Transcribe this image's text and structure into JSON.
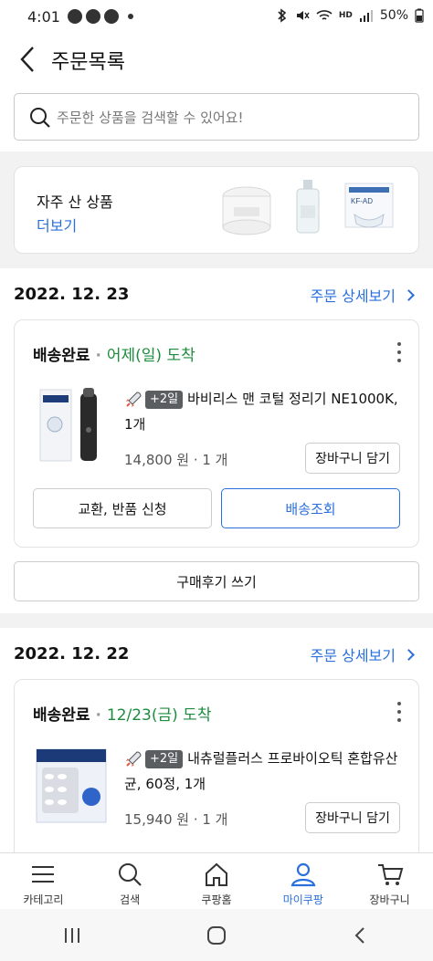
{
  "status_bar": {
    "time": "4:01",
    "net_label": "HD",
    "battery": "50%"
  },
  "header": {
    "title": "주문목록"
  },
  "search": {
    "placeholder": "주문한 상품을 검색할 수 있어요!"
  },
  "frequent": {
    "title": "자주 산 상품",
    "more": "더보기"
  },
  "orders": [
    {
      "date": "2022. 12. 23",
      "detail_link": "주문 상세보기",
      "status": "배송완료",
      "arrival": "어제(일) 도착",
      "badge": "+2일",
      "product_name": "바비리스 맨 코털 정리기 NE1000K, 1개",
      "price": "14,800 원 · 1 개",
      "cart_label": "장바구니 담기",
      "exchange_label": "교환, 반품 신청",
      "track_label": "배송조회",
      "review_label": "구매후기 쓰기"
    },
    {
      "date": "2022. 12. 22",
      "detail_link": "주문 상세보기",
      "status": "배송완료",
      "arrival": "12/23(금) 도착",
      "badge": "+2일",
      "product_name": "내츄럴플러스 프로바이오틱 혼합유산균, 60정, 1개",
      "price": "15,940 원 · 1 개",
      "cart_label": "장바구니 담기"
    }
  ],
  "bottom_nav": [
    {
      "label": "카테고리",
      "icon": "menu-icon"
    },
    {
      "label": "검색",
      "icon": "search-icon"
    },
    {
      "label": "쿠팡홈",
      "icon": "home-icon"
    },
    {
      "label": "마이쿠팡",
      "icon": "user-icon",
      "active": true
    },
    {
      "label": "장바구니",
      "icon": "cart-icon"
    }
  ],
  "colors": {
    "accent": "#2a6fdb",
    "arrival_green": "#1e8c3e"
  }
}
